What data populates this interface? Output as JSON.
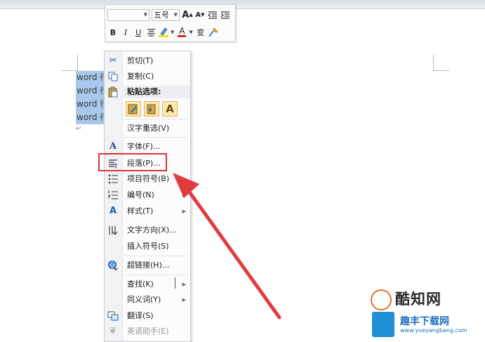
{
  "mini_toolbar": {
    "font_name": "",
    "font_size": "五号",
    "grow_label": "A",
    "shrink_label": "A",
    "bold": "B",
    "italic": "I",
    "underline": "U",
    "font_color_label": "A",
    "phonetic_label": "变"
  },
  "document": {
    "lines": [
      "word 行",
      "word 行",
      "word 行",
      "word 行"
    ],
    "paragraph_mark": "↵"
  },
  "menu": {
    "cut": "剪切(T)",
    "copy": "复制(C)",
    "paste_header": "粘贴选项:",
    "paste_text_only": "A",
    "reconvert": "汉字重选(V)",
    "font": "字体(F)...",
    "paragraph": "段落(P)...",
    "bullets": "项目符号(B)",
    "numbering": "编号(N)",
    "styles": "样式(T)",
    "text_direction": "文字方向(X)...",
    "insert_symbol": "插入符号(S)",
    "hyperlink": "超链接(H)...",
    "find": "查找(K)",
    "synonyms": "同义词(Y)",
    "translate": "翻译(S)",
    "english_assistant": "英语助手(E)"
  },
  "watermarks": {
    "brand1": "酷知网",
    "brand2": "趣丰下载网",
    "url": "www.yueyangbang.com"
  },
  "colors": {
    "highlight_box": "#d6343a",
    "arrow": "#e23b3f",
    "selection": "#a7c8ea"
  }
}
